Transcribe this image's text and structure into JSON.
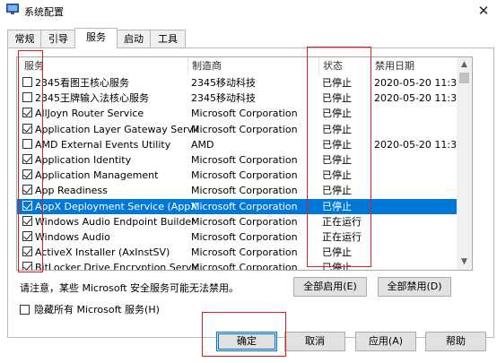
{
  "window": {
    "title": "系统配置",
    "close_label": "✕"
  },
  "tabs": [
    {
      "label": "常规"
    },
    {
      "label": "引导"
    },
    {
      "label": "服务"
    },
    {
      "label": "启动"
    },
    {
      "label": "工具"
    }
  ],
  "table": {
    "headers": [
      "服务",
      "制造商",
      "状态",
      "禁用日期"
    ],
    "rows": [
      {
        "name": "2345看图王核心服务",
        "maker": "2345移动科技",
        "status": "已停止",
        "date": "2020-05-20 11:3...",
        "checked": false
      },
      {
        "name": "2345王牌输入法核心服务",
        "maker": "2345移动科技",
        "status": "已停止",
        "date": "2020-05-20 11:3...",
        "checked": false
      },
      {
        "name": "AllJoyn Router Service",
        "maker": "Microsoft Corporation",
        "status": "已停止",
        "date": "",
        "checked": true
      },
      {
        "name": "Application Layer Gateway Service",
        "maker": "Microsoft Corporation",
        "status": "已停止",
        "date": "",
        "checked": true
      },
      {
        "name": "AMD External Events Utility",
        "maker": "AMD",
        "status": "已停止",
        "date": "2020-05-20 11:3...",
        "checked": false
      },
      {
        "name": "Application Identity",
        "maker": "Microsoft Corporation",
        "status": "已停止",
        "date": "",
        "checked": true
      },
      {
        "name": "Application Management",
        "maker": "Microsoft Corporation",
        "status": "已停止",
        "date": "",
        "checked": true
      },
      {
        "name": "App Readiness",
        "maker": "Microsoft Corporation",
        "status": "已停止",
        "date": "",
        "checked": true
      },
      {
        "name": "AppX Deployment Service (AppX...",
        "maker": "Microsoft Corporation",
        "status": "已停止",
        "date": "",
        "checked": true,
        "selected": true
      },
      {
        "name": "Windows Audio Endpoint Builder",
        "maker": "Microsoft Corporation",
        "status": "正在运行",
        "date": "",
        "checked": true
      },
      {
        "name": "Windows Audio",
        "maker": "Microsoft Corporation",
        "status": "正在运行",
        "date": "",
        "checked": true
      },
      {
        "name": "ActiveX Installer (AxInstSV)",
        "maker": "Microsoft Corporation",
        "status": "已停止",
        "date": "",
        "checked": true
      },
      {
        "name": "BitLocker Drive Encryption Service",
        "maker": "Microsoft Corporation",
        "status": "已停止",
        "date": "",
        "checked": true
      }
    ]
  },
  "scrollbar": {
    "up": "▲",
    "down": "▼"
  },
  "note": "请注意，某些 Microsoft 安全服务可能无法禁用。",
  "buttons": {
    "enable_all": "全部启用(E)",
    "disable_all": "全部禁用(D)",
    "ok": "确定",
    "cancel": "取消",
    "apply": "应用(A)",
    "help": "帮助"
  },
  "hide_ms": {
    "label": "隐藏所有 Microsoft 服务(H)",
    "checked": false
  },
  "colors": {
    "selection": "#0078d7",
    "annotation": "#e0201b"
  }
}
